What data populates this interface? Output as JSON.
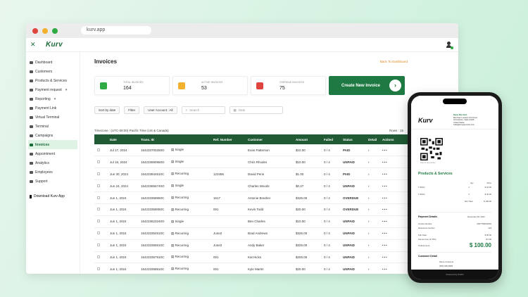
{
  "browser": {
    "url": "kurv.app"
  },
  "app": {
    "logo": "Kurv"
  },
  "sidebar": {
    "items": [
      {
        "label": "Dashboard"
      },
      {
        "label": "Customers"
      },
      {
        "label": "Products & Services"
      },
      {
        "label": "Payment request",
        "chevron": "chevron-down-icon"
      },
      {
        "label": "Reporting",
        "chevron": "chevron-down-icon"
      },
      {
        "label": "Payment Link"
      },
      {
        "label": "Virtual Terminal"
      },
      {
        "label": "Terminal"
      },
      {
        "label": "Campaigns"
      },
      {
        "label": "Invoices",
        "active": true
      },
      {
        "label": "Appointment"
      },
      {
        "label": "Analytics"
      },
      {
        "label": "Employees"
      },
      {
        "label": "Support"
      }
    ],
    "download": "Download Kurv App"
  },
  "main": {
    "title": "Invoices",
    "back_link": "Back To Dashboard",
    "cards": [
      {
        "label": "TOTAL INVOICES",
        "value": "164",
        "color": "#2faa45"
      },
      {
        "label": "ACTIVE INVOICES",
        "value": "53",
        "color": "#f3b130"
      },
      {
        "label": "OVERDUE INVOICES",
        "value": "75",
        "color": "#e0443e"
      }
    ],
    "create_button": "Create New Invoice",
    "filters": {
      "sort": "Sort by date",
      "filter": "Filter",
      "account": "User Account : All",
      "search_placeholder": "Search",
      "date_placeholder": "Date"
    },
    "timezone": "Timezone : (UTC-08:00) Pacific Time (US & Canada)",
    "rows_label": "Rows : 15",
    "table": {
      "headers": [
        "",
        "Date",
        "Trans. ID",
        "",
        "Ref. Number",
        "Customer",
        "Amount",
        "Failed",
        "Status",
        "Detail",
        "Actions"
      ],
      "rows": [
        {
          "date": "Jul 17, 2024",
          "id": "154233700250O",
          "type": "Single",
          "ref": "",
          "customer": "Evan Patterson",
          "amount": "$10.00",
          "failed": "0 / 4",
          "status": "PAID"
        },
        {
          "date": "Jul 16, 2024",
          "id": "154233690950O",
          "type": "Single",
          "ref": "",
          "customer": "Chris Rhodes",
          "amount": "$10.00",
          "failed": "0 / 4",
          "status": "UNPAID"
        },
        {
          "date": "Jun 30, 2024",
          "id": "154233844510C",
          "type": "Recurring",
          "ref": "123456",
          "customer": "David Penn",
          "amount": "$1.00",
          "failed": "0 / 4",
          "status": "PAID"
        },
        {
          "date": "Jun 24, 2024",
          "id": "154233656740O",
          "type": "Single",
          "ref": "",
          "customer": "Charles Woods",
          "amount": "$0.27",
          "failed": "0 / 4",
          "status": "UNPAID"
        },
        {
          "date": "Jun 1, 2024",
          "id": "154233358950C",
          "type": "Recurring",
          "ref": "1617",
          "customer": "Antonie Brasher",
          "amount": "$325.00",
          "failed": "0 / 4",
          "status": "OVERDUE"
        },
        {
          "date": "Jun 1, 2024",
          "id": "154233359050C",
          "type": "Recurring",
          "ref": "001",
          "customer": "Kevin Todd",
          "amount": "$20.00",
          "failed": "0 / 4",
          "status": "OVERDUE"
        },
        {
          "date": "Jun 1, 2024",
          "id": "154233623240O",
          "type": "Single",
          "ref": "",
          "customer": "Ben Charles",
          "amount": "$10.00",
          "failed": "0 / 4",
          "status": "UNPAID"
        },
        {
          "date": "Jun 1, 2024",
          "id": "154233354510C",
          "type": "Recurring",
          "ref": "June2",
          "customer": "Brad Andrews",
          "amount": "$325.00",
          "failed": "0 / 4",
          "status": "UNPAID"
        },
        {
          "date": "Jun 1, 2024",
          "id": "154233355510C",
          "type": "Recurring",
          "ref": "June2",
          "customer": "Andy Baker",
          "amount": "$325.00",
          "failed": "0 / 4",
          "status": "UNPAID"
        },
        {
          "date": "Jun 1, 2024",
          "id": "154233357510C",
          "type": "Recurring",
          "ref": "001",
          "customer": "Kat Hicks",
          "amount": "$200.00",
          "failed": "0 / 4",
          "status": "UNPAID"
        },
        {
          "date": "Jun 1, 2024",
          "id": "154233358510C",
          "type": "Recurring",
          "ref": "001",
          "customer": "Kyle Martin",
          "amount": "$20.00",
          "failed": "0 / 4",
          "status": "UNPAID"
        }
      ]
    }
  },
  "phone": {
    "logo": "Kurv",
    "merchant_name": "Name Merchant",
    "merchant_addr1": "Merchant Location 123 Home",
    "merchant_addr2": "Somewhere, State 12345",
    "merchant_addr3": "United States",
    "merchant_email": "hello@kurvpayments.com",
    "qr_caption": "Scan to view invoice",
    "section_products": "Products & Services",
    "col_qty": "Qty",
    "col_price": "Price",
    "lines": [
      {
        "name": "T-Shirts",
        "qty": "1",
        "price": "$ 10.00"
      },
      {
        "name": "T-Shirts",
        "qty": "2",
        "price": "$ 40.00"
      },
      {
        "name": "Sub Total",
        "qty": "",
        "price": "$ 100.00"
      }
    ],
    "payment_label": "Payment Details",
    "payment_date": "December 08, 2024",
    "pay_rows": [
      {
        "k": "Invoice Number",
        "v": "006776R032040"
      },
      {
        "k": "Reference Number",
        "v": "123"
      },
      {
        "k": "Sub Total",
        "v": "$ 95.00"
      },
      {
        "k": "Service Fee (4.75%)",
        "v": "$ 5.00"
      }
    ],
    "total_label": "Total Amount",
    "total": "$ 100.00",
    "customer_label": "Customer Detail",
    "customer_name": "Name Customer",
    "customer_phone": "(555) 655-5555",
    "footer": "Powered by KURV"
  }
}
